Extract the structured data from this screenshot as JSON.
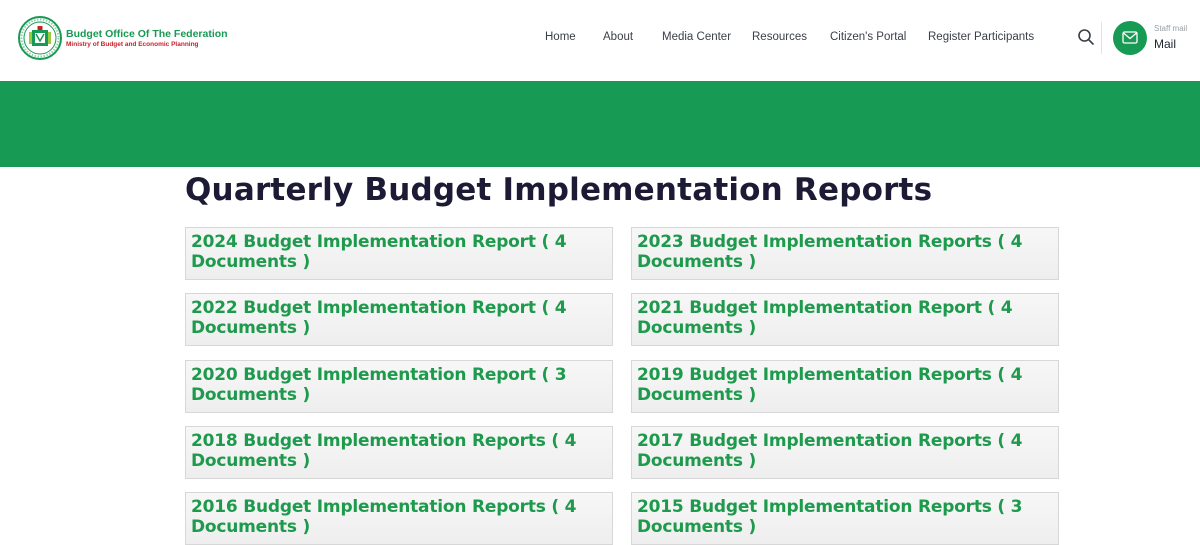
{
  "header": {
    "org_name": "Budget Office Of The Federation",
    "ministry": "Ministry of Budget and Economic Planning",
    "nav": [
      "Home",
      "About",
      "Media Center",
      "Resources",
      "Citizen's Portal",
      "Register Participants"
    ],
    "staff_mail_label": "Staff mail",
    "mail_label": "Mail"
  },
  "main": {
    "title": "Quarterly Budget Implementation Reports",
    "reports": [
      "2024 Budget Implementation Report ( 4 Documents )",
      "2023 Budget Implementation Reports ( 4 Documents )",
      "2022 Budget Implementation Report ( 4 Documents )",
      "2021 Budget Implementation Report ( 4 Documents )",
      "2020 Budget Implementation Report ( 3 Documents )",
      "2019 Budget Implementation Reports ( 4 Documents )",
      "2018 Budget Implementation Reports ( 4 Documents )",
      "2017 Budget Implementation Reports ( 4 Documents )",
      "2016 Budget Implementation Reports ( 4 Documents )",
      "2015 Budget Implementation Reports ( 3 Documents )"
    ]
  },
  "colors": {
    "brand_green": "#179a53",
    "link_green": "#1e9a4d",
    "title_dark": "#1d1a36",
    "ministry_red": "#c8202a"
  },
  "icons": [
    "coat-of-arms-logo",
    "search-icon",
    "mail-icon"
  ]
}
